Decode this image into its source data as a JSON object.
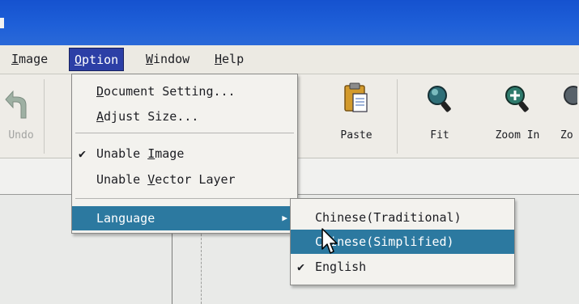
{
  "colors": {
    "titlebar": "#1e5fd8",
    "menu_active": "#2c3fa6",
    "menu_highlight": "#2c79a0",
    "menu_background": "#f3f2ee"
  },
  "menubar": {
    "items": [
      {
        "label": "Image",
        "mnemonic": "I",
        "rest": "mage"
      },
      {
        "label": "Option",
        "mnemonic": "O",
        "rest": "ption",
        "active": true
      },
      {
        "label": "Window",
        "mnemonic": "W",
        "rest": "indow"
      },
      {
        "label": "Help",
        "mnemonic": "H",
        "rest": "elp"
      }
    ]
  },
  "toolbar": {
    "undo": {
      "label": "Undo",
      "icon": "undo-arrow-icon",
      "enabled": false
    },
    "paste": {
      "label": "Paste",
      "icon": "clipboard-icon"
    },
    "fit": {
      "label": "Fit",
      "icon": "magnifier-icon"
    },
    "zoom_in": {
      "label": "Zoom In",
      "icon": "zoom-in-icon"
    },
    "zoom_out": {
      "label": "Zo",
      "icon": "zoom-out-icon"
    }
  },
  "option_menu": {
    "document_setting": {
      "mnemonic": "D",
      "rest": "ocument Setting..."
    },
    "adjust_size": {
      "mnemonic": "A",
      "rest": "djust Size..."
    },
    "unable_image": {
      "before": "Unable ",
      "mnemonic": "I",
      "rest": "mage",
      "checked": true
    },
    "unable_vector": {
      "before": "Unable ",
      "mnemonic": "V",
      "rest": "ector Layer"
    },
    "language": {
      "label": "Language",
      "has_submenu": true
    }
  },
  "language_submenu": {
    "items": [
      {
        "label": "Chinese(Traditional)"
      },
      {
        "label": "Chinese(Simplified)",
        "highlighted": true
      },
      {
        "label": "English",
        "checked": true
      }
    ]
  }
}
